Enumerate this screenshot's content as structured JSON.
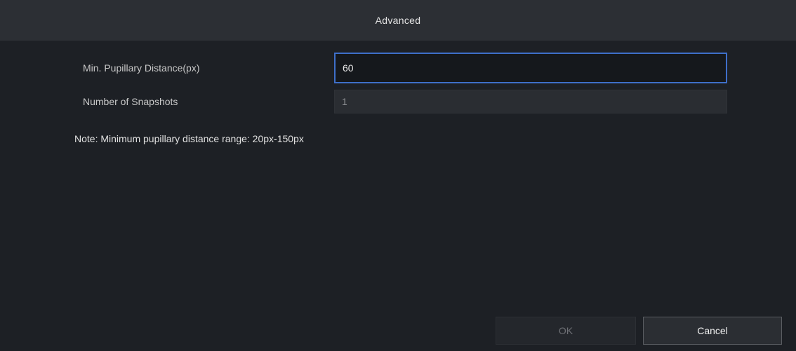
{
  "dialog": {
    "title": "Advanced"
  },
  "form": {
    "min_pupillary_label": "Min. Pupillary Distance(px)",
    "min_pupillary_value": "60",
    "snapshots_label": "Number of Snapshots",
    "snapshots_value": "1"
  },
  "note": "Note: Minimum pupillary distance range: 20px-150px",
  "buttons": {
    "ok_label": "OK",
    "cancel_label": "Cancel"
  },
  "colors": {
    "accent_focus": "#3e6fc9",
    "background": "#1d2025",
    "titlebar": "#2c2f34"
  }
}
